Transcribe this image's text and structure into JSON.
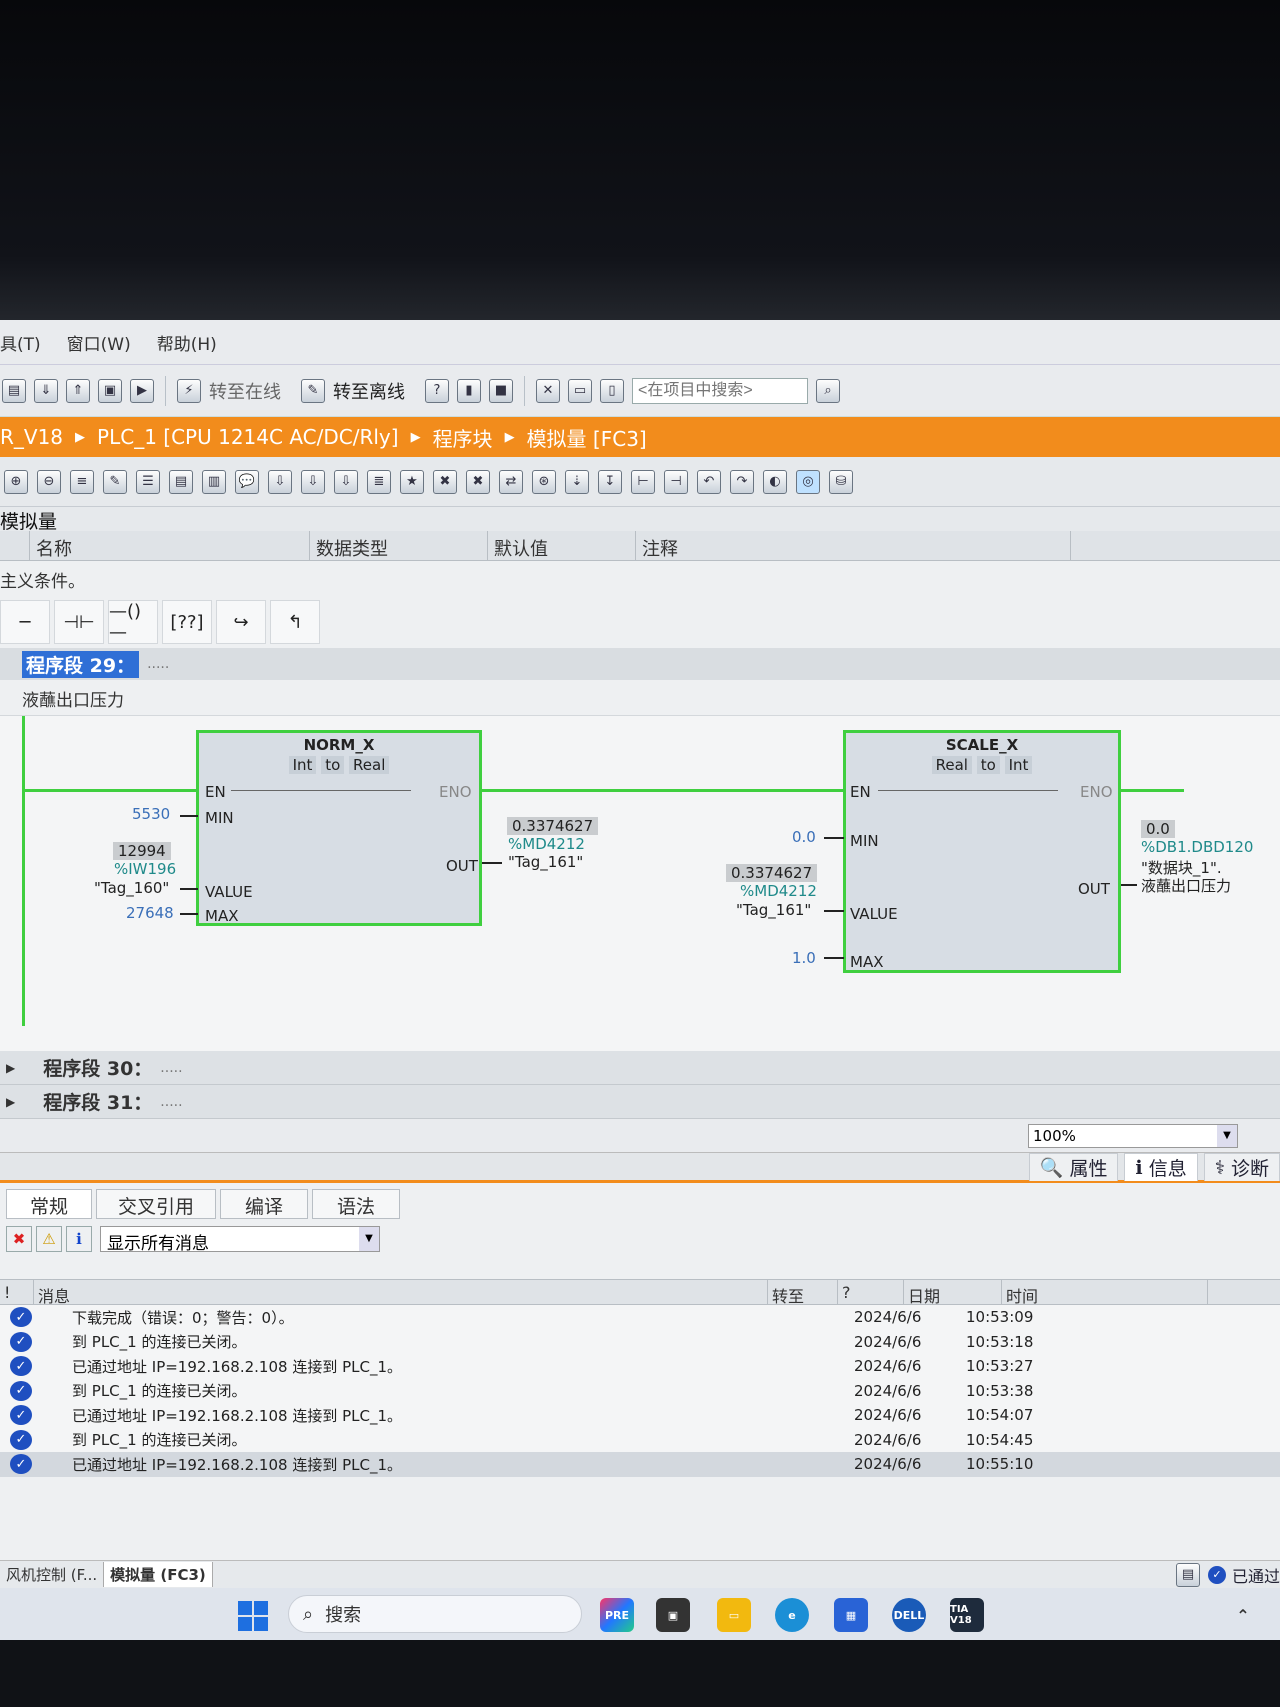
{
  "menu": {
    "tools": "具(T)",
    "window": "窗口(W)",
    "help": "帮助(H)"
  },
  "toolbar": {
    "go_online": "转至在线",
    "go_offline": "转至离线",
    "search_placeholder": "<在项目中搜索>"
  },
  "breadcrumb": {
    "project": "R_V18",
    "plc": "PLC_1 [CPU 1214C AC/DC/Rly]",
    "blocks": "程序块",
    "block": "模拟量 [FC3]"
  },
  "block_name": "模拟量",
  "interface_columns": [
    "名称",
    "数据类型",
    "默认值",
    "注释"
  ],
  "condition_text": "主义条件。",
  "network29": {
    "title": "程序段 29：",
    "dots": ".....",
    "comment": "液蘸出口压力"
  },
  "norm_x": {
    "name": "NORM_X",
    "type_in": "Int",
    "to": "to",
    "type_out": "Real",
    "pins": {
      "en": "EN",
      "eno": "ENO",
      "min": "MIN",
      "value": "VALUE",
      "max": "MAX",
      "out": "OUT"
    },
    "min_value": "5530",
    "value_live": "12994",
    "value_addr": "%IW196",
    "value_tag": "\"Tag_160\"",
    "max_value": "27648",
    "out_live": "0.3374627",
    "out_addr": "%MD4212",
    "out_tag": "\"Tag_161\""
  },
  "scale_x": {
    "name": "SCALE_X",
    "type_in": "Real",
    "to": "to",
    "type_out": "Int",
    "pins": {
      "en": "EN",
      "eno": "ENO",
      "min": "MIN",
      "value": "VALUE",
      "max": "MAX",
      "out": "OUT"
    },
    "min_value": "0.0",
    "value_live": "0.3374627",
    "value_addr": "%MD4212",
    "value_tag": "\"Tag_161\"",
    "max_value": "1.0",
    "out_live": "0.0",
    "out_addr": "%DB1.DBD120",
    "out_tag1": "\"数据块_1\".",
    "out_tag2": "液蘸出口压力"
  },
  "network30": {
    "title": "程序段 30：",
    "dots": "....."
  },
  "network31": {
    "title": "程序段 31：",
    "dots": "....."
  },
  "zoom": "100%",
  "panel_tabs": {
    "properties": "属性",
    "info": "信息",
    "diagnostics": "诊断"
  },
  "info_tabs": [
    "常规",
    "交叉引用",
    "编译",
    "语法"
  ],
  "filter": "显示所有消息",
  "msg_columns": {
    "bang": "!",
    "message": "消息",
    "goto": "转至",
    "q": "?",
    "date": "日期",
    "time": "时间"
  },
  "messages": [
    {
      "text": "下载完成（错误：0；警告：0）。",
      "date": "2024/6/6",
      "time": "10:53:09"
    },
    {
      "text": "到 PLC_1 的连接已关闭。",
      "date": "2024/6/6",
      "time": "10:53:18"
    },
    {
      "text": "已通过地址 IP=192.168.2.108 连接到 PLC_1。",
      "date": "2024/6/6",
      "time": "10:53:27"
    },
    {
      "text": "到 PLC_1 的连接已关闭。",
      "date": "2024/6/6",
      "time": "10:53:38"
    },
    {
      "text": "已通过地址 IP=192.168.2.108 连接到 PLC_1。",
      "date": "2024/6/6",
      "time": "10:54:07"
    },
    {
      "text": "到 PLC_1 的连接已关闭。",
      "date": "2024/6/6",
      "time": "10:54:45"
    },
    {
      "text": "已通过地址 IP=192.168.2.108 连接到 PLC_1。",
      "date": "2024/6/6",
      "time": "10:55:10"
    }
  ],
  "editor_tabs": [
    "风机控制 (F...",
    "模拟量 (FC3)"
  ],
  "status_right": "已通过",
  "taskbar": {
    "search": "搜索",
    "tia": "TIA V18"
  },
  "colors": {
    "accent": "#f28c1c",
    "wire": "#3fcf3f",
    "address": "#1f8a8a"
  }
}
